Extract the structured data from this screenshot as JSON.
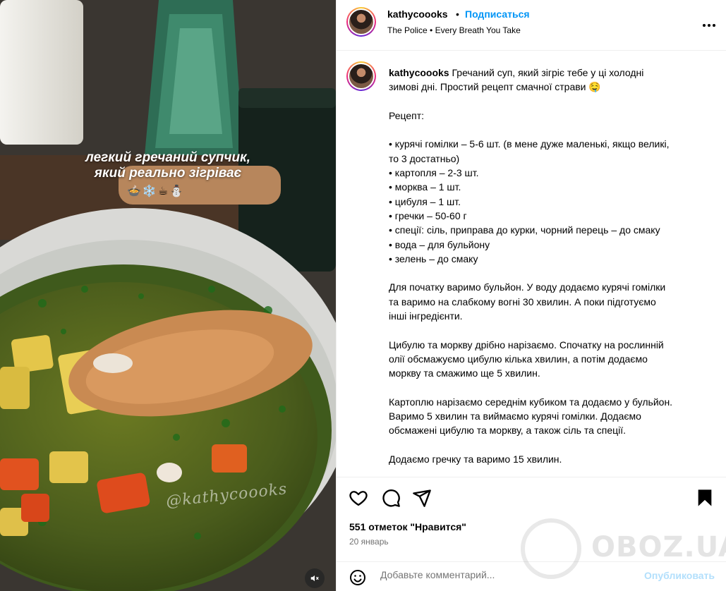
{
  "media": {
    "overlay_line1": "легкий гречаний супчик,",
    "overlay_line2": "який реально зігріває",
    "emoji_row": "🍲❄️☕⛄",
    "watermark": "@kathycoooks"
  },
  "header": {
    "username": "kathycoooks",
    "dot": "•",
    "follow_label": "Подписаться",
    "song": "The Police • Every Breath You Take",
    "more_icon": "more-horizontal-icon"
  },
  "caption": {
    "username": "kathycoooks",
    "text": " Гречаний суп, який зігріє тебе у ці холодні\nзимові дні. Простий рецепт смачної страви 🤤\n\nРецепт:\n\n• курячі гомілки – 5-6 шт. (в мене дуже маленькі, якщо великі,\nто 3 достатньо)\n• картопля – 2-3 шт.\n• морква – 1 шт.\n• цибуля – 1 шт.\n• гречки – 50-60 г\n• спеції: сіль, приправа до курки, чорний перець – до смаку\n• вода – для бульйону\n• зелень – до смаку\n\nДля початку варимо бульйон. У воду додаємо курячі гомілки\nта варимо на слабкому вогні 30 хвилин. А поки підготуємо\nінші інгредієнти.\n\nЦибулю та моркву дрібно нарізаємо. Спочатку на рослинній\nолії обсмажуємо цибулю кілька хвилин, а потім додаємо\nморкву та смажимо ще 5 хвилин.\n\nКартоплю нарізаємо середнім кубиком та додаємо у бульйон.\nВаримо 5 хвилин та виймаємо курячі гомілки. Додаємо\nобсмажені цибулю та моркву, а також сіль та спеції.\n\nДодаємо гречку та варимо 15 хвилин."
  },
  "actions": {
    "likes": "551 отметок \"Нравится\"",
    "date": "20 январь"
  },
  "comment": {
    "placeholder": "Добавьте комментарий...",
    "publish_label": "Опубликовать"
  },
  "brand_watermark": "OBOZ.UA",
  "colors": {
    "accent": "#0095f6",
    "publish_disabled": "#b2dffc",
    "muted_text": "#737373",
    "divider": "#efefef"
  }
}
